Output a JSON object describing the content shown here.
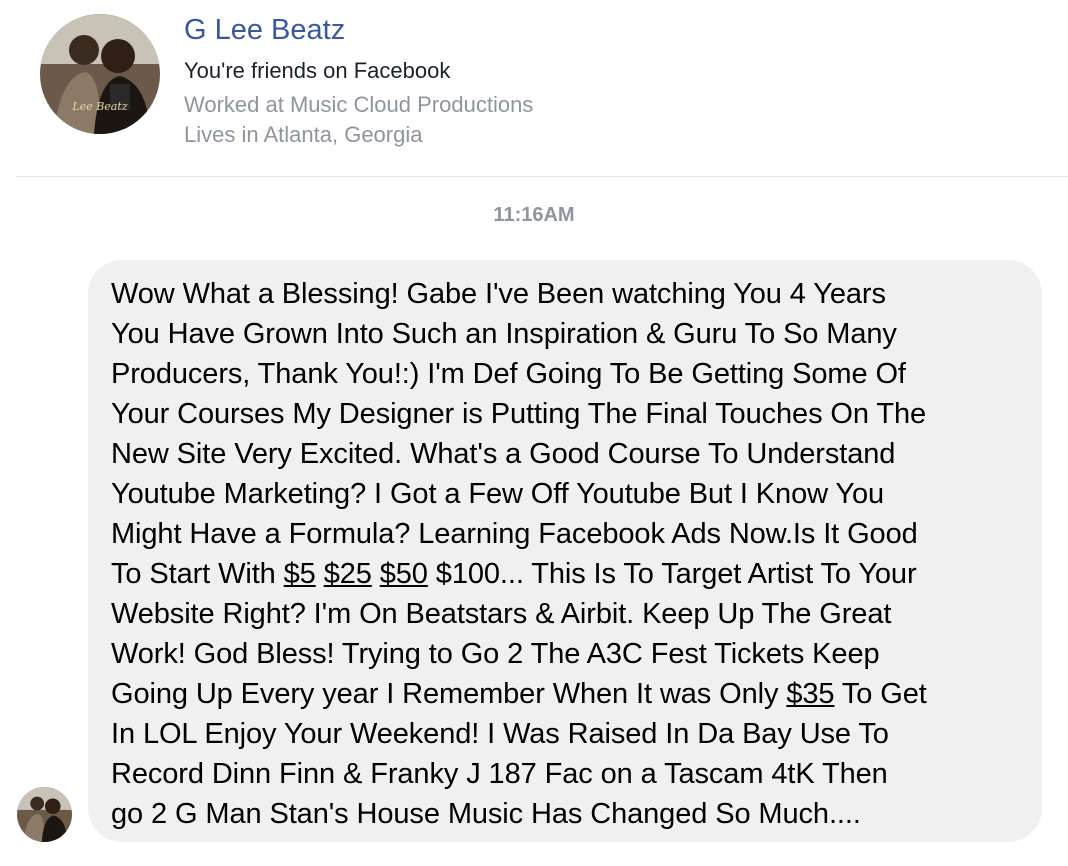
{
  "profile": {
    "name": "G Lee Beatz",
    "friend_status": "You're friends on Facebook",
    "work": "Worked at Music Cloud Productions",
    "location": "Lives in Atlanta, Georgia",
    "avatar_logo_text": "Lee Beatz"
  },
  "conversation": {
    "timestamp": "11:16AM",
    "message": {
      "lines": [
        [
          "Wow What a Blessing! Gabe I've Been watching You 4 Years"
        ],
        [
          "You Have Grown Into Such an Inspiration & Guru To So Many"
        ],
        [
          "Producers, Thank You!:) I'm Def Going To Be Getting Some Of"
        ],
        [
          "Your Courses My Designer is Putting The Final Touches On The"
        ],
        [
          "New Site Very Excited. What's a Good Course To Understand"
        ],
        [
          "Youtube Marketing? I Got a Few Off Youtube But I Know You"
        ],
        [
          "Might Have a Formula? Learning Facebook Ads Now.Is It Good"
        ],
        [
          "To Start With ",
          "$5",
          " ",
          "$25",
          " ",
          "$50",
          " $100... This Is To Target Artist To Your"
        ],
        [
          "Website Right? I'm On Beatstars & Airbit. Keep Up The Great"
        ],
        [
          "Work! God Bless! Trying to Go 2 The A3C Fest Tickets Keep"
        ],
        [
          "Going Up Every year I Remember When It was Only ",
          "$35",
          " To Get"
        ],
        [
          "In LOL Enjoy Your Weekend! I Was Raised In Da Bay Use To"
        ],
        [
          "Record Dinn Finn & Franky J 187 Fac on a Tascam 4tK  Then"
        ],
        [
          "go 2 G Man Stan's House Music Has Changed So Much...."
        ]
      ]
    }
  },
  "colors": {
    "name": "#3b5998",
    "secondary_text": "#90949c",
    "bubble": "#f1f0f0"
  }
}
